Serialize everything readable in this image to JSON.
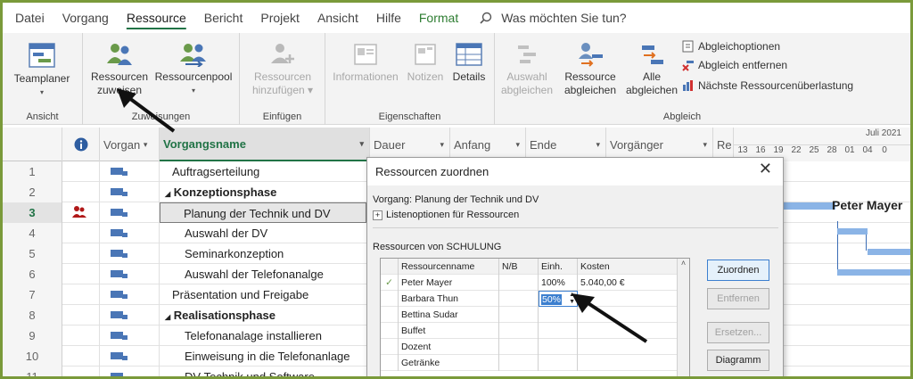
{
  "menu": {
    "tabs": [
      "Datei",
      "Vorgang",
      "Ressource",
      "Bericht",
      "Projekt",
      "Ansicht",
      "Hilfe",
      "Format"
    ],
    "active_tab": "Ressource",
    "tell_me": "Was möchten Sie tun?"
  },
  "ribbon": {
    "ansicht": {
      "button": "Teamplaner",
      "group_label": "Ansicht"
    },
    "zuweisungen": {
      "assign_line1": "Ressourcen",
      "assign_line2": "zuweisen",
      "pool": "Ressourcenpool",
      "group_label": "Zuweisungen"
    },
    "einfuegen": {
      "line1": "Ressourcen",
      "line2": "hinzufügen",
      "group_label": "Einfügen"
    },
    "eigenschaften": {
      "info": "Informationen",
      "notes": "Notizen",
      "details": "Details",
      "group_label": "Eigenschaften"
    },
    "abgleich": {
      "auswahl_line1": "Auswahl",
      "auswahl_line2": "abgleichen",
      "ressource_line1": "Ressource",
      "ressource_line2": "abgleichen",
      "alle_line1": "Alle",
      "alle_line2": "abgleichen",
      "options": "Abgleichoptionen",
      "remove": "Abgleich entfernen",
      "next": "Nächste Ressourcenüberlastung",
      "group_label": "Abgleich"
    }
  },
  "grid": {
    "headers": {
      "mode": "Vorgan",
      "name": "Vorgangsname",
      "dauer": "Dauer",
      "anfang": "Anfang",
      "ende": "Ende",
      "vorgaenger": "Vorgänger",
      "res": "Re"
    },
    "timeline": {
      "month": "Juli 2021",
      "days": [
        "13",
        "16",
        "19",
        "22",
        "25",
        "28",
        "01",
        "04",
        "0"
      ]
    },
    "rows": [
      {
        "num": "1",
        "name": "Auftragserteilung"
      },
      {
        "num": "2",
        "name": "Konzeptionsphase"
      },
      {
        "num": "3",
        "name": "Planung der Technik und DV"
      },
      {
        "num": "4",
        "name": "Auswahl der DV"
      },
      {
        "num": "5",
        "name": "Seminarkonzeption"
      },
      {
        "num": "6",
        "name": "Auswahl der Telefonanalge"
      },
      {
        "num": "7",
        "name": "Präsentation und Freigabe"
      },
      {
        "num": "8",
        "name": "Realisationsphase"
      },
      {
        "num": "9",
        "name": "Telefonanalage installieren"
      },
      {
        "num": "10",
        "name": "Einweisung in die Telefonanlage"
      },
      {
        "num": "11",
        "name": "DV-Technik und Software"
      }
    ],
    "gantt_label": "Peter Mayer"
  },
  "dialog": {
    "title": "Ressourcen zuordnen",
    "vorgang": "Vorgang: Planung der Technik und DV",
    "listenoptionen": "Listenoptionen für Ressourcen",
    "from_label": "Ressourcen von SCHULUNG",
    "columns": {
      "name": "Ressourcenname",
      "nb": "N/B",
      "einh": "Einh.",
      "kosten": "Kosten"
    },
    "resources": [
      {
        "name": "Peter Mayer",
        "einh": "100%",
        "kosten": "5.040,00 €"
      },
      {
        "name": "Barbara Thun",
        "einh": "50%",
        "kosten": ""
      },
      {
        "name": "Bettina Sudar",
        "einh": "",
        "kosten": ""
      },
      {
        "name": "Buffet",
        "einh": "",
        "kosten": ""
      },
      {
        "name": "Dozent",
        "einh": "",
        "kosten": ""
      },
      {
        "name": "Getränke",
        "einh": "",
        "kosten": ""
      }
    ],
    "buttons": {
      "assign": "Zuordnen",
      "remove": "Entfernen",
      "replace": "Ersetzen...",
      "chart": "Diagramm"
    }
  }
}
